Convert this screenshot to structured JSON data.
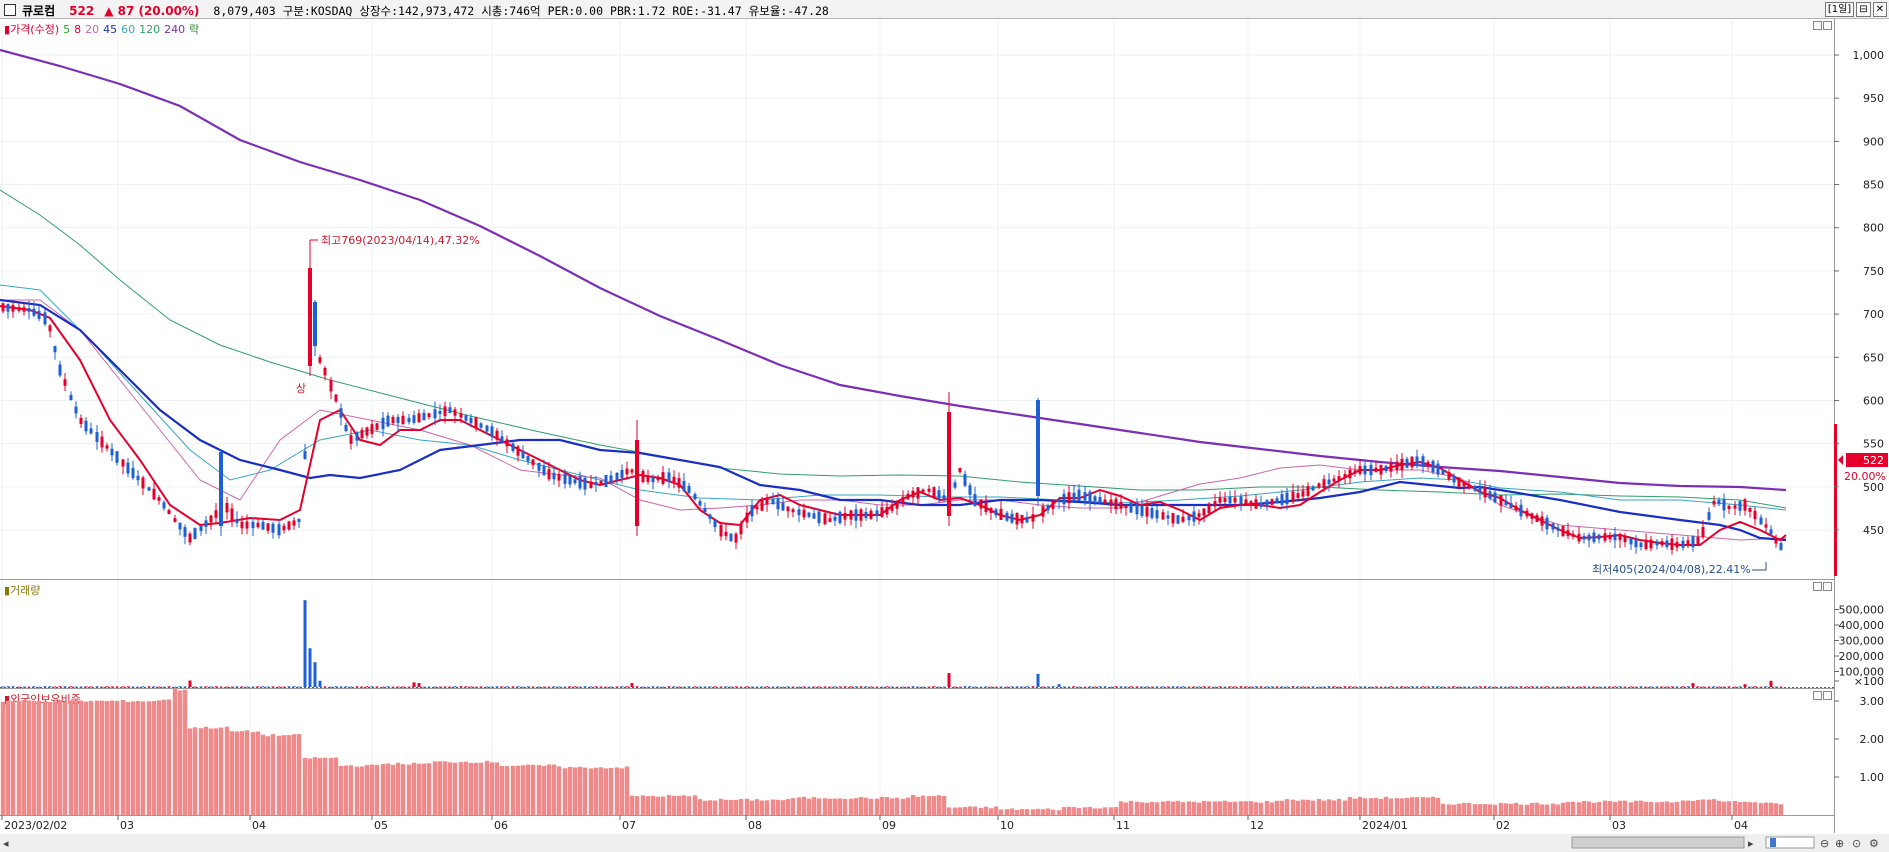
{
  "header": {
    "name": "큐로컴",
    "price": "522",
    "change": "▲ 87 (20.00%)",
    "volume": "8,079,403",
    "market": "구분:KOSDAQ",
    "shares": "상장수:142,973,472",
    "market_cap": "시총:746억",
    "per": "PER:0.00",
    "pbr": "PBR:1.72",
    "roe": "ROE:-31.47",
    "float_ratio": "유보율:-47.28",
    "period_label": "[1일]",
    "restore_label": "⊟",
    "close_label": "✕"
  },
  "price_panel": {
    "legend": [
      {
        "label": "가격(수정)",
        "color": "#e4002b"
      },
      {
        "label": "5",
        "color": "#22aa22"
      },
      {
        "label": "8",
        "color": "#e4002b"
      },
      {
        "label": "20",
        "color": "#cc66aa"
      },
      {
        "label": "45",
        "color": "#1a2fc2"
      },
      {
        "label": "60",
        "color": "#3aa5c0"
      },
      {
        "label": "120",
        "color": "#2f9e6b"
      },
      {
        "label": "240",
        "color": "#7b2fb5"
      },
      {
        "label": "락",
        "color": "#2a8a2a"
      }
    ],
    "y_ticks": [
      "1,000",
      "950",
      "900",
      "850",
      "800",
      "750",
      "700",
      "650",
      "600",
      "550",
      "500",
      "450"
    ],
    "high_annotation": "최고769(2023/04/14),47.32%",
    "low_annotation": "최저405(2024/04/08),22.41%",
    "sang_label": "상",
    "current_price_tag": "522",
    "current_pct_tag": "20.00%"
  },
  "volume_panel": {
    "legend": "거래량",
    "y_ticks": [
      "500,000",
      "400,000",
      "300,000",
      "200,000",
      "100,000",
      "×100"
    ]
  },
  "foreign_panel": {
    "legend": "외국인보유비중",
    "y_ticks": [
      "3.00",
      "2.00",
      "1.00"
    ]
  },
  "x_axis": {
    "labels": [
      "2023/02/02",
      "03",
      "04",
      "05",
      "06",
      "07",
      "08",
      "09",
      "10",
      "11",
      "12",
      "2024/01",
      "02",
      "03",
      "04"
    ]
  },
  "colors": {
    "up": "#e4002b",
    "down": "#1f5fd6",
    "ma5": "#22aa22",
    "ma8": "#e4002b",
    "ma20": "#cc66aa",
    "ma45": "#1a2fc2",
    "ma60": "#3aa5c0",
    "ma120": "#2f9e6b",
    "ma240": "#7b2fb5",
    "foreign_bar": "#f08a8a"
  },
  "chart_data": {
    "type": "candlestick",
    "x_range": [
      "2023/02/02",
      "2024/04/19"
    ],
    "y_range_price": [
      405,
      1030
    ],
    "key_points": [
      {
        "date": "2023/04/14",
        "high": 769
      },
      {
        "date": "2024/04/08",
        "low": 405
      },
      {
        "date": "2024/04/19",
        "close": 522
      }
    ],
    "ma240_trend": [
      1005,
      930,
      840,
      760,
      680,
      600,
      575,
      545,
      530,
      518,
      490
    ]
  }
}
